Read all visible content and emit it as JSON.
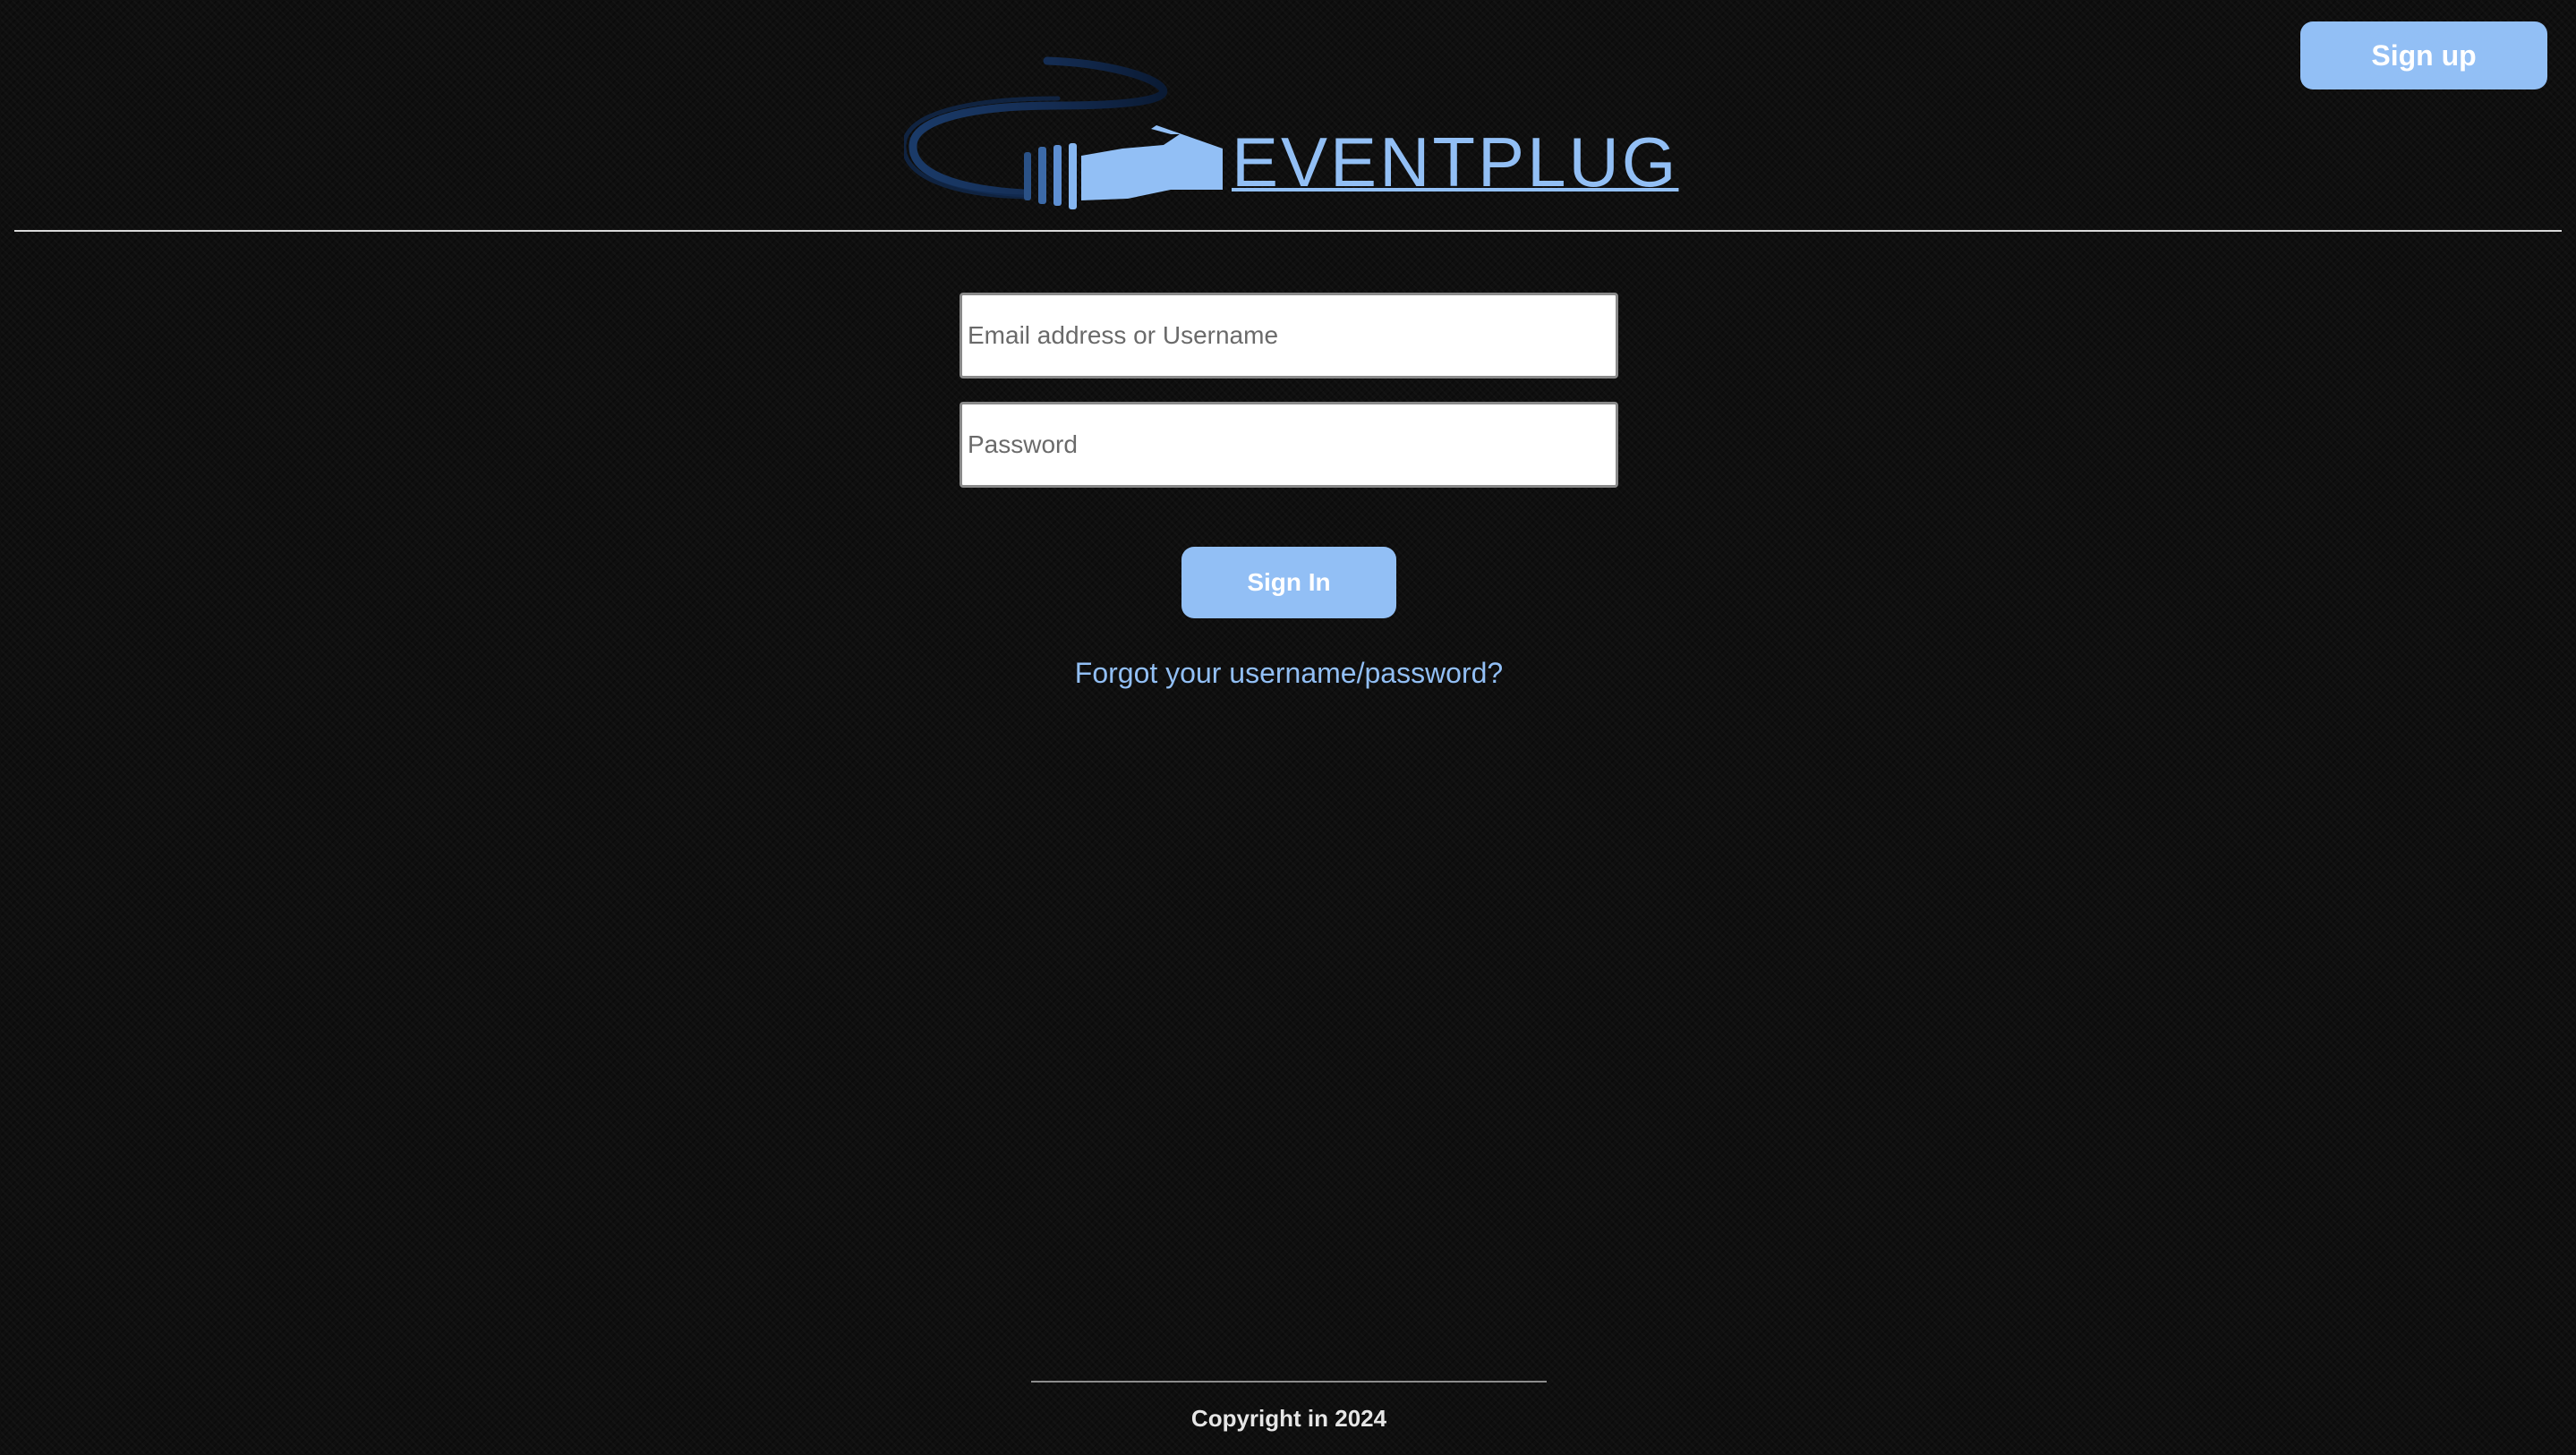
{
  "header": {
    "signup_label": "Sign up",
    "logo_text": "EVENTPLUG",
    "logo_icon": "cable-plug-icon"
  },
  "login_form": {
    "email_placeholder": "Email address or Username",
    "password_placeholder": "Password",
    "signin_label": "Sign In",
    "forgot_label": "Forgot your username/password?"
  },
  "footer": {
    "copyright": "Copyright in 2024"
  },
  "colors": {
    "accent": "#92bff5",
    "background": "#0f0f0f",
    "logo_cable_dark": "#1a3a68",
    "button_text": "#ffffff"
  }
}
